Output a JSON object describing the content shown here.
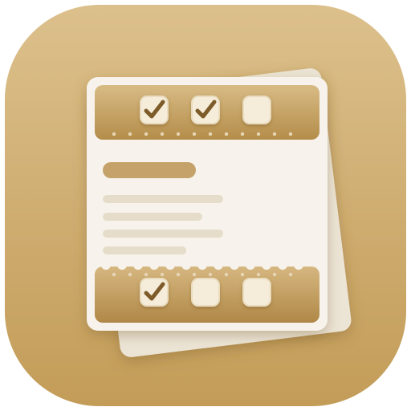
{
  "icon": {
    "subject": "checklist-document-app-icon",
    "colors": {
      "tile_light": "#dcc08c",
      "tile_dark": "#c39c58",
      "paper": "#f7f3ec",
      "paper_back": "#ece5d6",
      "band_light": "#d8bb85",
      "band_dark": "#b48d4a",
      "checkbox_fill": "#f5ecd9",
      "check_mark": "#7d5b2a",
      "title_bar": "#c5a26a",
      "text_line": "#e6dcca"
    },
    "top_band_checkboxes": [
      {
        "checked": true
      },
      {
        "checked": true
      },
      {
        "checked": false
      }
    ],
    "bottom_band_checkboxes": [
      {
        "checked": true
      },
      {
        "checked": false
      },
      {
        "checked": false
      }
    ],
    "text_line_count": 4
  }
}
